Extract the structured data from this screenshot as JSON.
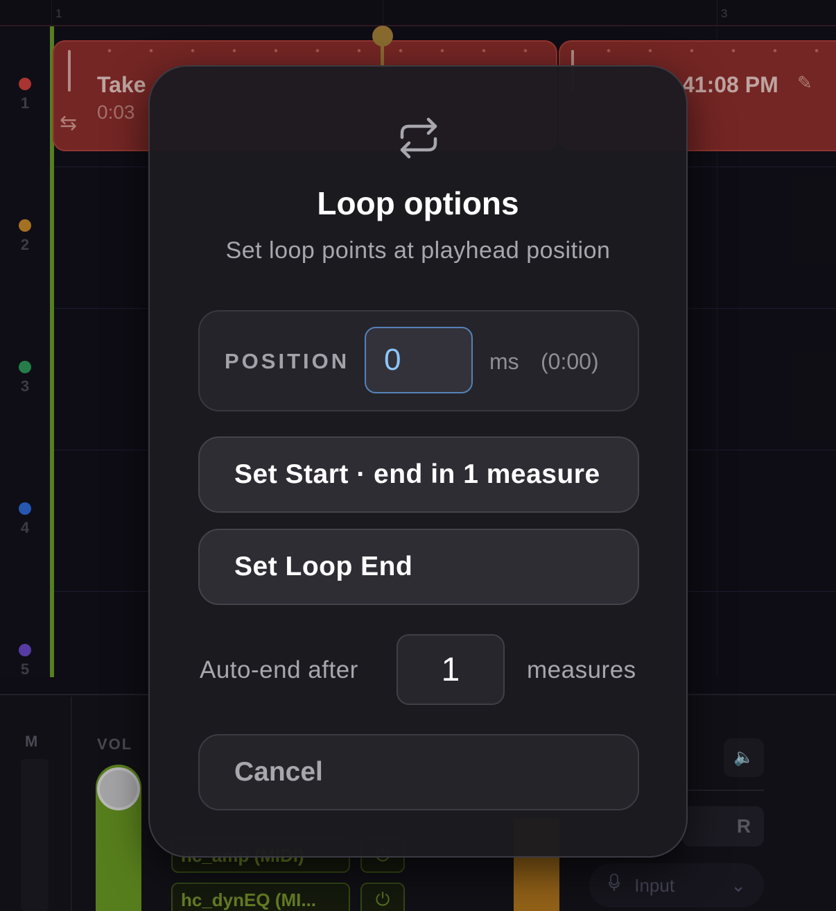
{
  "background": {
    "ruler": {
      "marks": [
        "1",
        "3"
      ]
    },
    "tracks": [
      {
        "number": "1",
        "color": "#d0403c"
      },
      {
        "number": "2",
        "color": "#c98a2a"
      },
      {
        "number": "3",
        "color": "#2e9a5a"
      },
      {
        "number": "4",
        "color": "#2f6bd8"
      },
      {
        "number": "5",
        "color": "#6a4ac8"
      }
    ],
    "clips": [
      {
        "title": "Take",
        "time": "0:03"
      },
      {
        "title": "41:08 PM"
      }
    ],
    "mixer": {
      "mute_label": "M",
      "volume_label": "VOL",
      "plugins": [
        "hc_amp (MIDI)",
        "hc_dynEQ (MI..."
      ],
      "record_label": "R",
      "input_select": "Input"
    }
  },
  "modal": {
    "title": "Loop options",
    "subtitle": "Set loop points at playhead position",
    "position": {
      "label": "POSITION",
      "value": "0",
      "unit": "ms",
      "time": "(0:00)"
    },
    "set_start_label": "Set Start · end in 1 measure",
    "set_end_label": "Set Loop End",
    "auto_end": {
      "label": "Auto-end after",
      "value": "1",
      "unit": "measures"
    },
    "cancel_label": "Cancel"
  }
}
